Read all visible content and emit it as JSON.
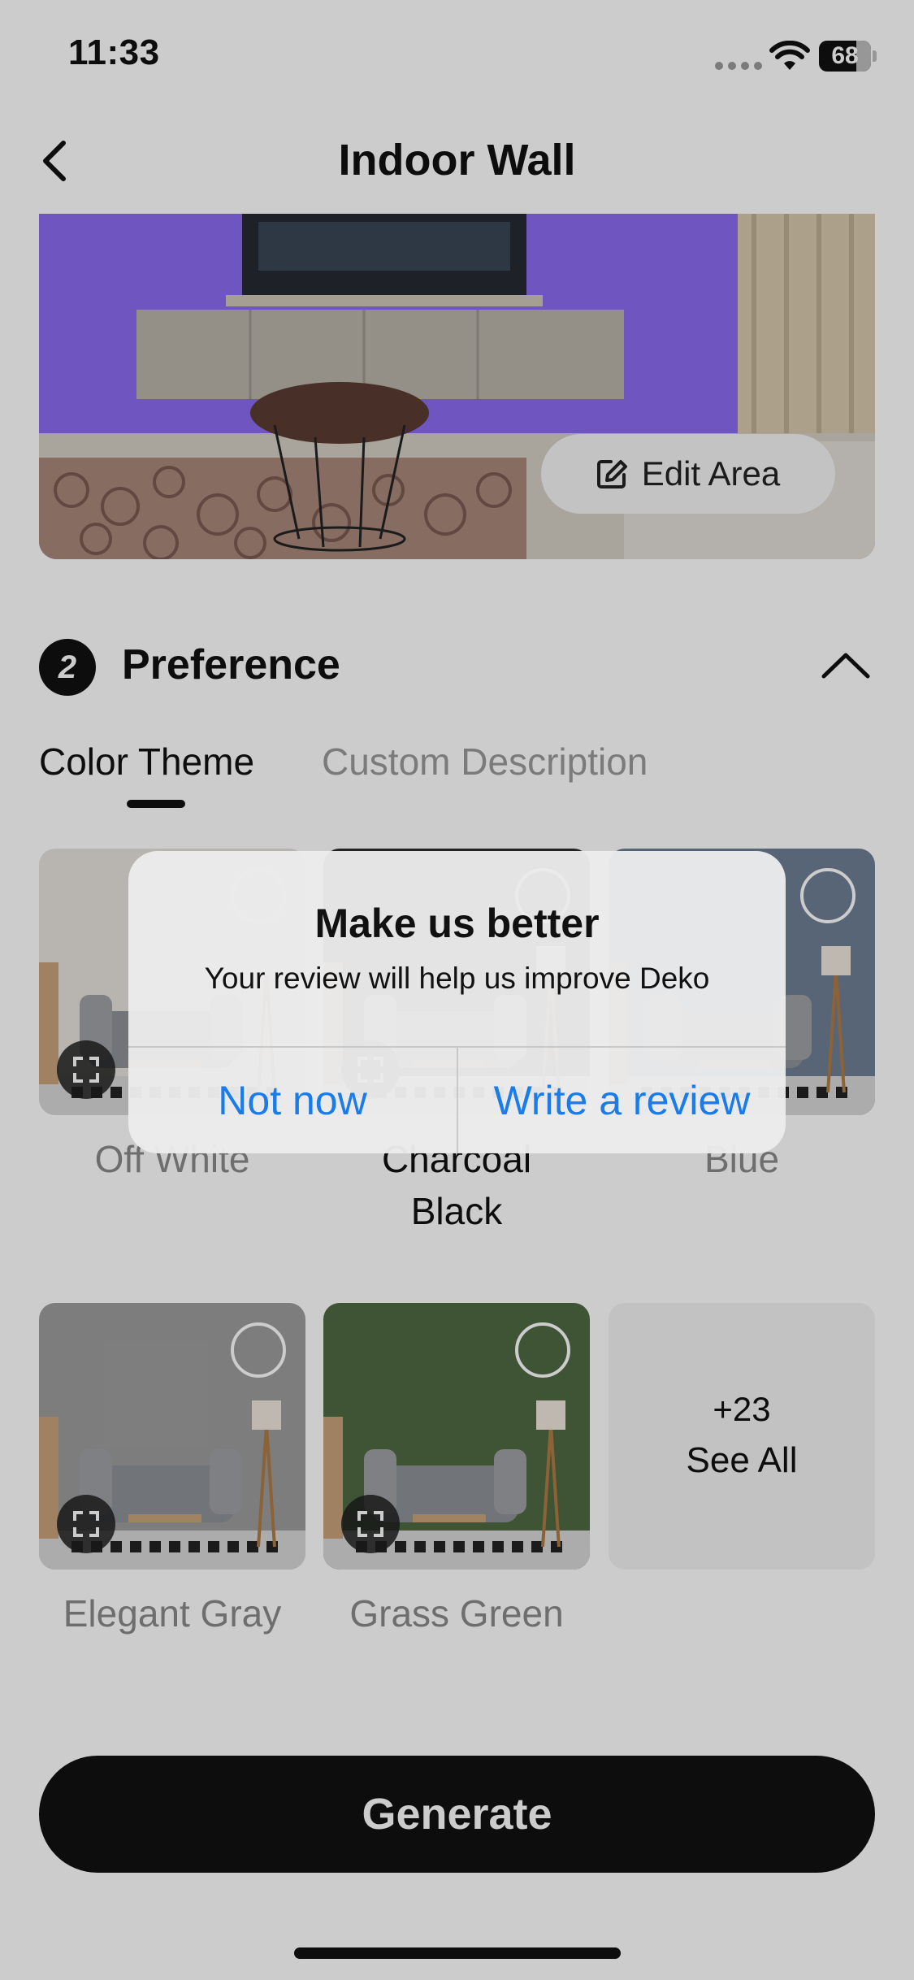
{
  "status_bar": {
    "time": "11:33",
    "battery": "68"
  },
  "header": {
    "title": "Indoor Wall",
    "back_icon": "chevron-left-icon"
  },
  "photo": {
    "edit_button_label": "Edit Area",
    "edit_icon": "edit-icon",
    "highlight_color": "#8a6bf0"
  },
  "preference": {
    "step_number": "2",
    "title": "Preference",
    "collapse_icon": "chevron-up-icon",
    "tabs": [
      {
        "label": "Color Theme",
        "active": true
      },
      {
        "label": "Custom Description",
        "active": false
      }
    ],
    "themes": [
      {
        "label": "Off White",
        "wall_color": "#e6e3dd",
        "selected": false
      },
      {
        "label": "Charcoal Black",
        "wall_color": "#2c2c2c",
        "selected": true
      },
      {
        "label": "Blue",
        "wall_color": "#6f7f94",
        "selected": false
      },
      {
        "label": "Elegant Gray",
        "wall_color": "#9d9d9d",
        "selected": false
      },
      {
        "label": "Grass Green",
        "wall_color": "#4e6a43",
        "selected": false
      }
    ],
    "see_all": {
      "count": "+23",
      "label": "See All"
    }
  },
  "generate_button": "Generate",
  "dialog": {
    "title": "Make us better",
    "message": "Your review will help us improve Deko",
    "buttons": {
      "dismiss": "Not now",
      "confirm": "Write a review"
    }
  },
  "colors": {
    "accent_blue": "#1a7bea",
    "dark": "#111111"
  }
}
